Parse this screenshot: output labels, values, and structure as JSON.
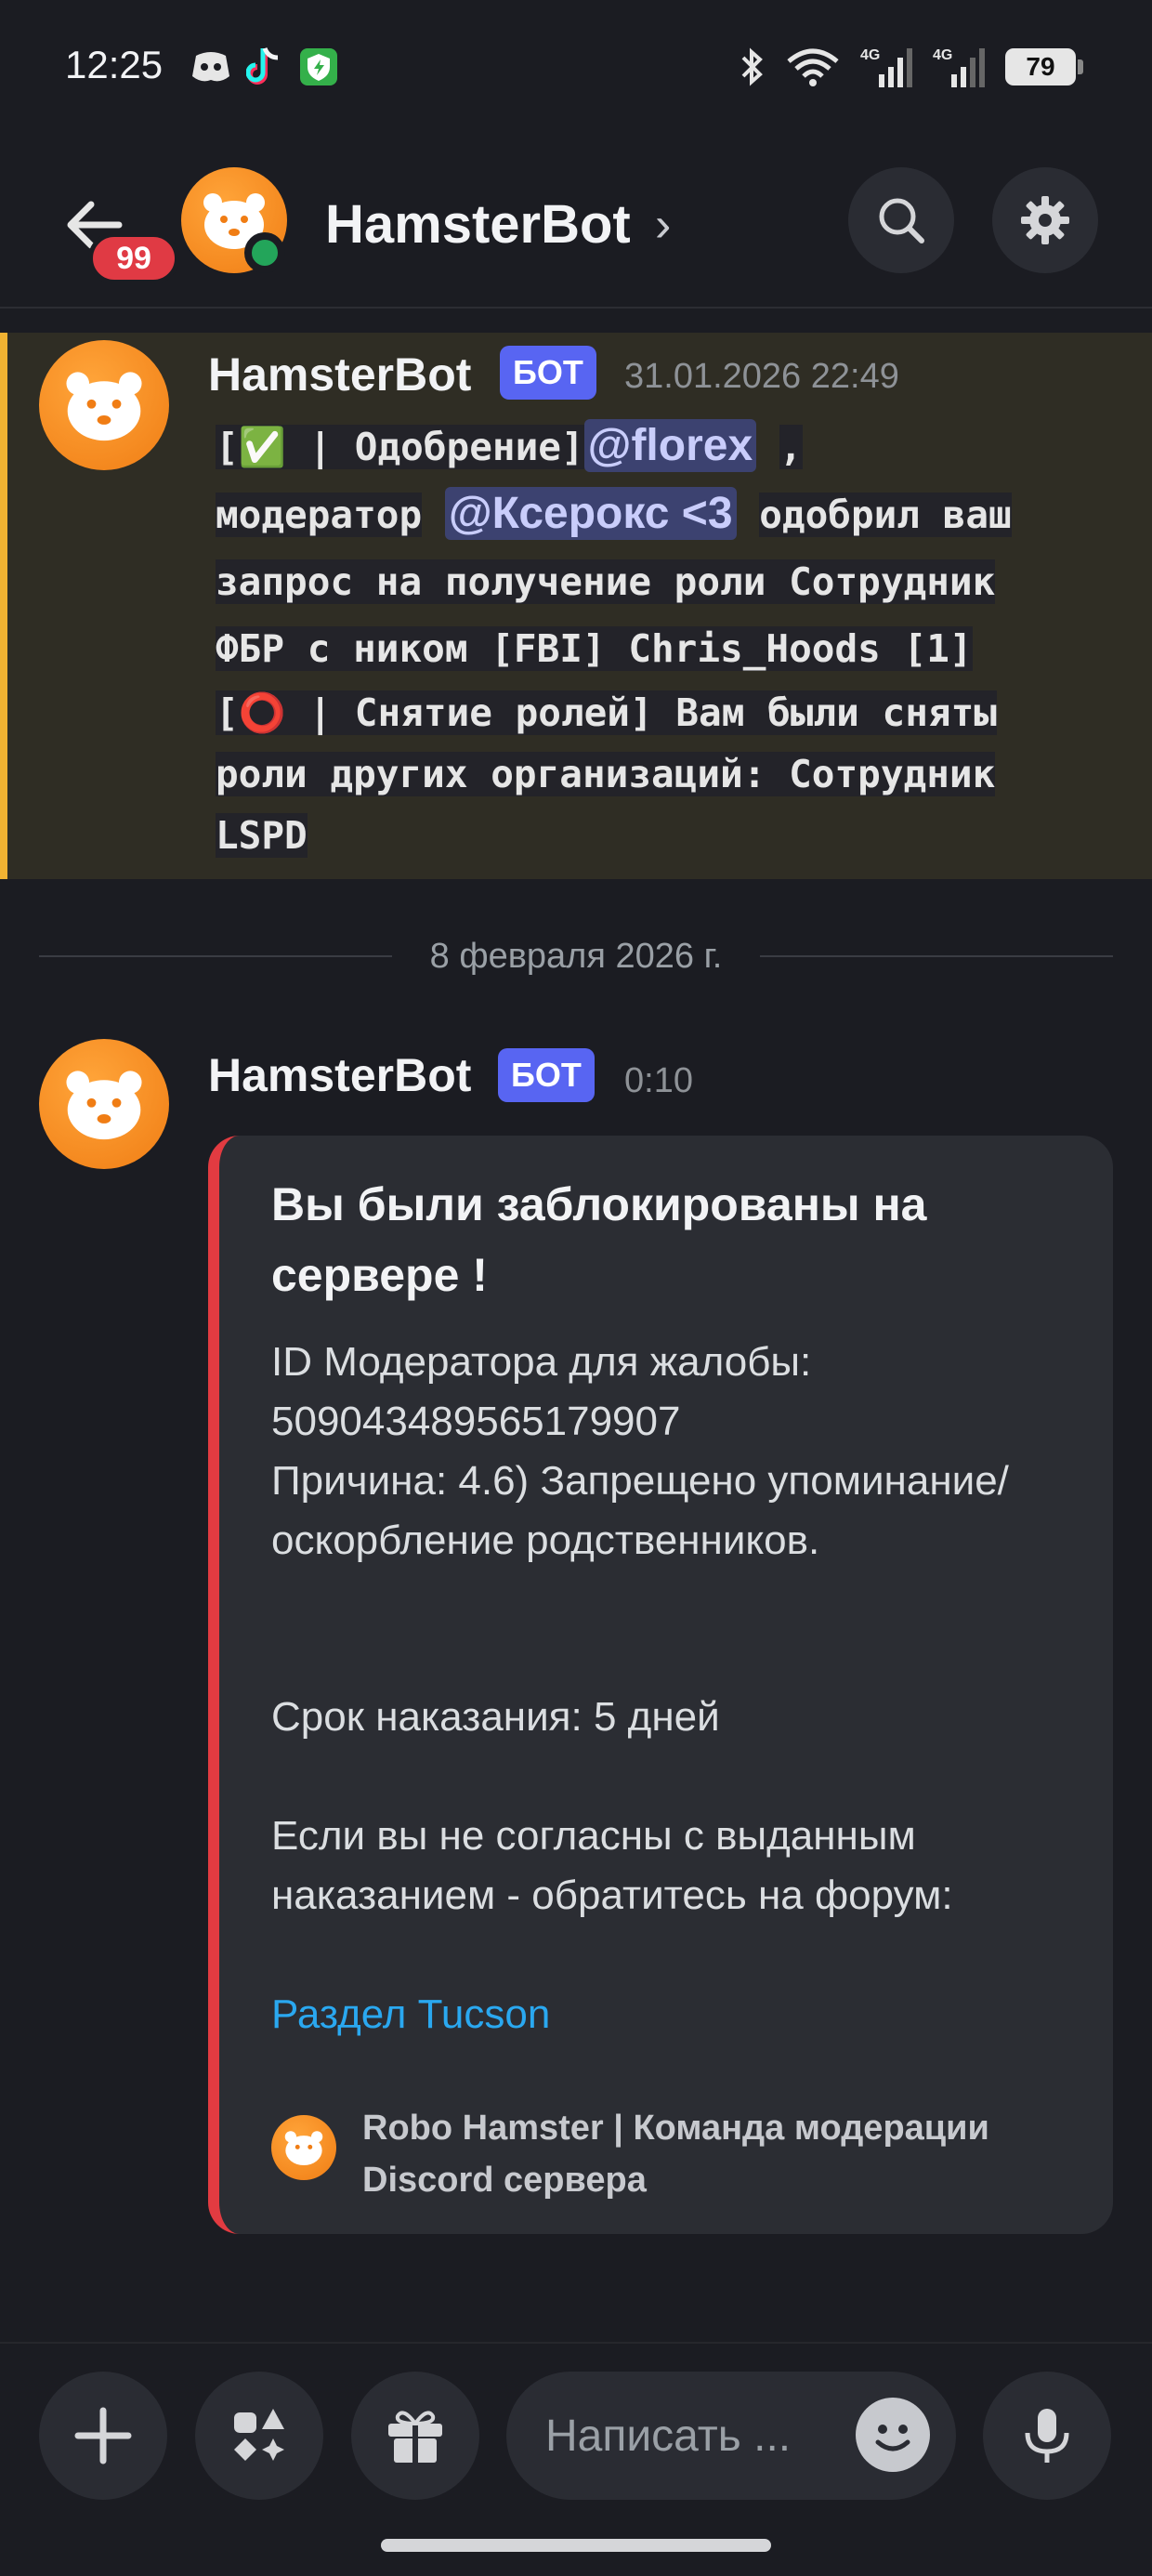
{
  "status_bar": {
    "time": "12:25",
    "left_icons": [
      "discord-icon",
      "tiktok-icon",
      "shield-icon"
    ],
    "right_icons": [
      "bluetooth-icon",
      "wifi-icon",
      "signal-4g-icon",
      "signal-4g-icon"
    ],
    "signal_label_1": "4G",
    "signal_label_2": "4G",
    "battery": "79"
  },
  "header": {
    "badge_count": "99",
    "title": "HamsterBot",
    "chevron": "›",
    "online": true,
    "accent_online": "#23a55a"
  },
  "message1": {
    "author": "HamsterBot",
    "bot_tag": "БОТ",
    "timestamp": "31.01.2026 22:49",
    "line1_prefix": "[✅ | Одобрение]",
    "mention1": "@florex",
    "line1_suffix": ",",
    "line2_prefix": "модератор",
    "mention2": "@Ксерокс <3",
    "line2_suffix": "одобрил ваш",
    "line3": "запрос на получение роли Сотрудник",
    "line4": "ФБР с ником [FBI] Chris_Hoods [1]",
    "line5": "[⭕ | Снятие ролей] Вам были сняты",
    "line6": "роли других организаций: Сотрудник",
    "line7": "LSPD",
    "highlight_color": "#f0b232"
  },
  "divider": {
    "date": "8 февраля 2026 г."
  },
  "message2": {
    "author": "HamsterBot",
    "bot_tag": "БОТ",
    "timestamp": "0:10",
    "embed": {
      "title": "Вы были заблокированы на сервере !",
      "lines": [
        "ID Модератора для жалобы:",
        "509043489565179907",
        "Причина: 4.6) Запрещено упоминание/",
        "оскорбление родственников.",
        "",
        "",
        "Срок наказания: 5 дней",
        "",
        "Если вы не согласны с выданным",
        "наказанием - обратитесь на форум:",
        "",
        "Раздел Tucson"
      ],
      "footer": "Robo Hamster | Команда модерации Discord сервера",
      "border_color": "#e23b41"
    }
  },
  "composer": {
    "placeholder": "Написать ..."
  }
}
